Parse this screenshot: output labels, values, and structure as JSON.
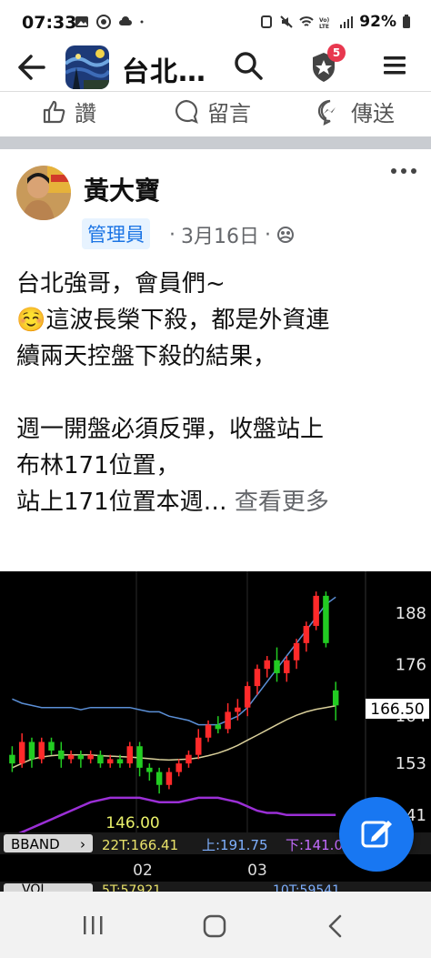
{
  "status_bar": {
    "time": "07:33",
    "battery": "92%",
    "left_icons": [
      "gallery-icon",
      "chrome-icon",
      "cloud-icon",
      "dot-icon"
    ],
    "right_icons": [
      "sim-icon",
      "mute-icon",
      "wifi-icon",
      "volte-icon",
      "signal-icon"
    ]
  },
  "topbar": {
    "group_title": "台北…",
    "notification_count": "5"
  },
  "actions": {
    "like": "讚",
    "comment": "留言",
    "share": "傳送"
  },
  "post": {
    "author": "黃大寶",
    "role_badge": "管理員",
    "date": "3月16日",
    "separator": "·",
    "lines": [
      "台北強哥，會員們~",
      "☺️這波長榮下殺，都是外資連",
      "續兩天控盤下殺的結果，",
      "",
      "週一開盤必須反彈，收盤站上",
      "布林171位置，",
      "站上171位置本週…"
    ],
    "see_more": "查看更多"
  },
  "chart_data": {
    "type": "candlestick",
    "y_ticks": [
      "188",
      "176",
      "164",
      "153",
      "141"
    ],
    "price_label": "166.50",
    "annotation": "146.00",
    "x_ticks": [
      "02",
      "03"
    ],
    "indicator": {
      "name": "BBAND",
      "mid": "22T:166.41",
      "upper": "上:191.75",
      "lower": "下:141.0"
    },
    "volume": {
      "name": "VOL",
      "left": "5T:57921",
      "right": "10T:59541"
    },
    "ylim": [
      138,
      196
    ],
    "candles": [
      {
        "o": 155,
        "h": 157,
        "l": 151,
        "c": 153,
        "up": false
      },
      {
        "o": 153,
        "h": 160,
        "l": 152,
        "c": 158,
        "up": true
      },
      {
        "o": 158,
        "h": 159,
        "l": 152,
        "c": 154,
        "up": false
      },
      {
        "o": 154,
        "h": 159,
        "l": 153,
        "c": 158,
        "up": true
      },
      {
        "o": 158,
        "h": 159,
        "l": 155,
        "c": 156,
        "up": false
      },
      {
        "o": 156,
        "h": 158,
        "l": 152,
        "c": 154,
        "up": false
      },
      {
        "o": 154,
        "h": 156,
        "l": 153,
        "c": 155,
        "up": true
      },
      {
        "o": 155,
        "h": 156,
        "l": 152,
        "c": 154,
        "up": false
      },
      {
        "o": 154,
        "h": 156,
        "l": 153,
        "c": 155,
        "up": true
      },
      {
        "o": 155,
        "h": 156,
        "l": 152,
        "c": 153,
        "up": false
      },
      {
        "o": 153,
        "h": 155,
        "l": 152,
        "c": 154,
        "up": true
      },
      {
        "o": 154,
        "h": 155,
        "l": 152,
        "c": 153,
        "up": false
      },
      {
        "o": 153,
        "h": 158,
        "l": 152,
        "c": 157,
        "up": true
      },
      {
        "o": 157,
        "h": 158,
        "l": 150,
        "c": 152,
        "up": false
      },
      {
        "o": 152,
        "h": 153,
        "l": 149,
        "c": 151,
        "up": false
      },
      {
        "o": 151,
        "h": 152,
        "l": 146,
        "c": 148,
        "up": false
      },
      {
        "o": 148,
        "h": 152,
        "l": 147,
        "c": 151,
        "up": true
      },
      {
        "o": 151,
        "h": 154,
        "l": 150,
        "c": 153,
        "up": true
      },
      {
        "o": 153,
        "h": 156,
        "l": 152,
        "c": 155,
        "up": true
      },
      {
        "o": 155,
        "h": 161,
        "l": 154,
        "c": 159,
        "up": true
      },
      {
        "o": 159,
        "h": 163,
        "l": 158,
        "c": 162,
        "up": true
      },
      {
        "o": 162,
        "h": 164,
        "l": 160,
        "c": 161,
        "up": false
      },
      {
        "o": 161,
        "h": 167,
        "l": 160,
        "c": 165,
        "up": true
      },
      {
        "o": 165,
        "h": 168,
        "l": 163,
        "c": 166,
        "up": true
      },
      {
        "o": 166,
        "h": 172,
        "l": 164,
        "c": 171,
        "up": true
      },
      {
        "o": 171,
        "h": 176,
        "l": 169,
        "c": 175,
        "up": true
      },
      {
        "o": 175,
        "h": 178,
        "l": 173,
        "c": 177,
        "up": true
      },
      {
        "o": 177,
        "h": 180,
        "l": 172,
        "c": 174,
        "up": false
      },
      {
        "o": 174,
        "h": 178,
        "l": 172,
        "c": 177,
        "up": true
      },
      {
        "o": 177,
        "h": 182,
        "l": 175,
        "c": 181,
        "up": true
      },
      {
        "o": 181,
        "h": 186,
        "l": 179,
        "c": 185,
        "up": true
      },
      {
        "o": 185,
        "h": 193,
        "l": 184,
        "c": 192,
        "up": true
      },
      {
        "o": 192,
        "h": 193,
        "l": 180,
        "c": 181,
        "up": false
      },
      {
        "o": 170,
        "h": 172,
        "l": 163,
        "c": 166.5,
        "up": false
      }
    ]
  },
  "colors": {
    "brand": "#1877f2",
    "badge_red": "#e8384f",
    "candle_up": "#ff2a2a",
    "candle_down": "#22cc22",
    "upper_band": "#5b8fd6",
    "mid_band": "#d9cf9a",
    "lower_band": "#9b2fd6"
  }
}
